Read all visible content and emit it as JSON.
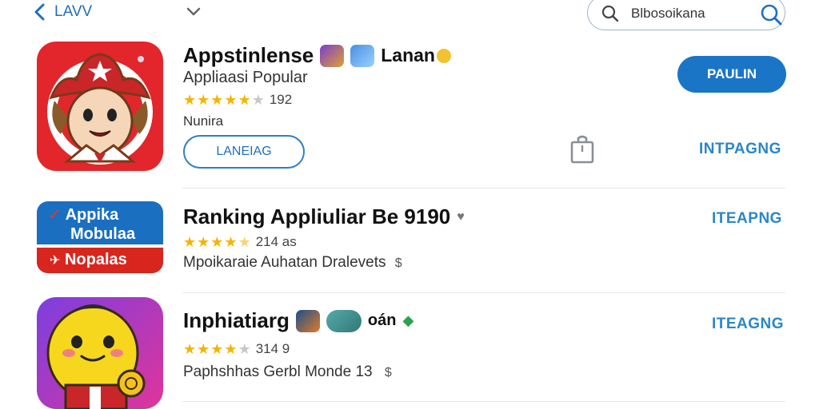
{
  "nav": {
    "back_label": "LAVV",
    "search_query": "Blbosoikana"
  },
  "apps": [
    {
      "title": "Appstinlense",
      "title_extra": "Lanan",
      "subtitle": "Appliaasi Popular",
      "rating_text": "192",
      "stars": 4.5,
      "meta": "Nunira",
      "open_label": "LANEIAG",
      "get_label": "PAULIN",
      "action_label": "INTPAGNG"
    },
    {
      "title": "Ranking Appliuliar Be 9190",
      "icon_line1": "Appika",
      "icon_line2": "Mobulaa",
      "icon_line3": "Nopalas",
      "rating_text": "214 as",
      "stars": 4.5,
      "meta": "Mpoikaraie Auhatan Dralevets",
      "action_label": "ITEAPNG"
    },
    {
      "title": "Inphiatiarg",
      "title_extra": "oán",
      "rating_text": "314 9",
      "stars": 4,
      "meta": "Paphshhas Gerbl Monde 13",
      "action_label": "ITEAGNG"
    }
  ],
  "colors": {
    "accent": "#1a75c7",
    "link": "#2a87c8",
    "star": "#f4b400",
    "icon1_bg": "#e3262b",
    "icon2_top": "#1b6fc0",
    "icon2_bottom": "#d8261f",
    "icon3_bg": "#9b3ad9"
  }
}
